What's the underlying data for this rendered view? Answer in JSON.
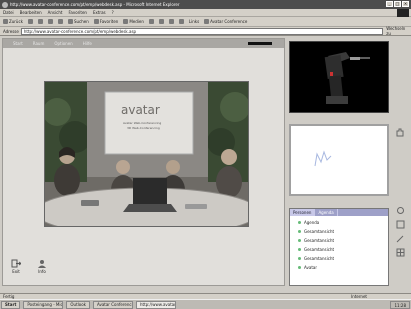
{
  "window": {
    "title": "http://www.avatar-conference.com/pt/emp/webdesk.asp - Microsoft Internet Explorer",
    "controls": [
      "_",
      "□",
      "×"
    ]
  },
  "menu": [
    "Datei",
    "Bearbeiten",
    "Ansicht",
    "Favoriten",
    "Extras",
    "?"
  ],
  "toolbar": [
    {
      "icon": "back-icon",
      "label": "Zurück"
    },
    {
      "icon": "forward-icon",
      "label": ""
    },
    {
      "icon": "stop-icon",
      "label": ""
    },
    {
      "icon": "refresh-icon",
      "label": ""
    },
    {
      "icon": "home-icon",
      "label": ""
    },
    {
      "icon": "search-icon",
      "label": "Suchen"
    },
    {
      "icon": "favorites-icon",
      "label": "Favoriten"
    },
    {
      "icon": "media-icon",
      "label": "Medien"
    },
    {
      "icon": "history-icon",
      "label": ""
    },
    {
      "icon": "mail-icon",
      "label": ""
    },
    {
      "icon": "print-icon",
      "label": ""
    },
    {
      "icon": "edit-icon",
      "label": ""
    },
    {
      "icon": "links-icon",
      "label": "Links"
    },
    {
      "icon": "conference-icon",
      "label": "Avatar Conference"
    }
  ],
  "address": {
    "label": "Adresse",
    "url": "http://www.avatar-conference.com/pt/emp/webdesk.asp",
    "go": "Wechseln zu"
  },
  "panel": {
    "subtabs": [
      "Start",
      "Raum",
      "Optionen",
      "Hilfe"
    ],
    "room_sign": {
      "brand": "avatar",
      "line1": "Avatar Web-Conferencing",
      "line2": "3D Web-Conferencing"
    }
  },
  "bottom_actions": [
    {
      "icon": "exit-icon",
      "label": "Exit"
    },
    {
      "icon": "user-icon",
      "label": "Info"
    }
  ],
  "participants": {
    "tabs": [
      "Personen",
      "Agenda"
    ],
    "items": [
      "Agenda",
      "Gesamtansicht",
      "Gesamtansicht",
      "Gesamtansicht",
      "Gesamtansicht",
      "Avatar"
    ]
  },
  "status": {
    "text": "Fertig",
    "zone": "Internet"
  },
  "taskbar": {
    "start": "Start",
    "tasks": [
      "Posteingang - Micros...",
      "Outlook",
      "Avatar Conference",
      "http://www.avatar-co..."
    ],
    "clock": "11:28"
  },
  "colors": {
    "accent": "#9ea0c8",
    "window": "#d4d0c8"
  }
}
